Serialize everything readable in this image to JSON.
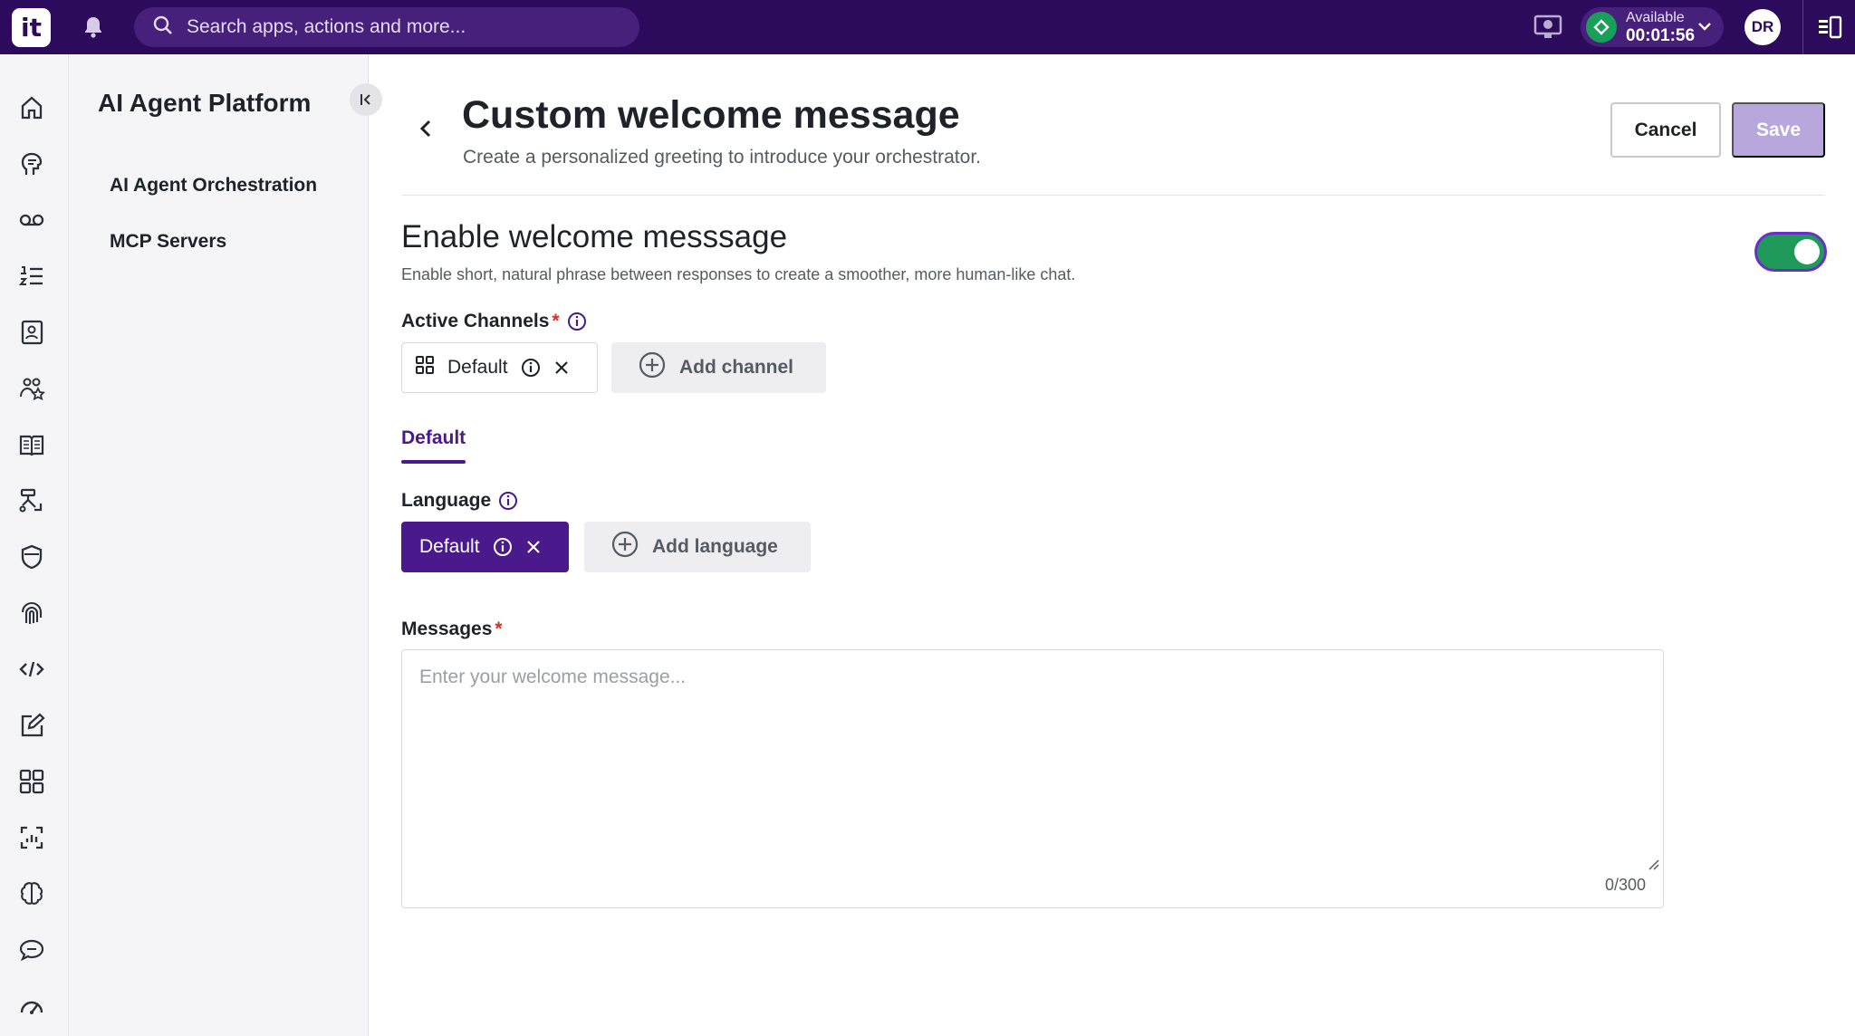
{
  "topbar": {
    "logo_text": "it",
    "search_placeholder": "Search apps, actions and more...",
    "status_label": "Available",
    "status_time": "00:01:56",
    "avatar_initials": "DR",
    "brand_color": "#2c0a5c"
  },
  "rail": {
    "icons": [
      "home-icon",
      "agent-head-icon",
      "voicemail-icon",
      "numbered-list-icon",
      "contact-book-icon",
      "team-star-icon",
      "open-book-icon",
      "flow-icon",
      "shield-icon",
      "fingerprint-icon",
      "code-icon",
      "edit-icon",
      "apps-grid-icon",
      "analytics-icon",
      "brain-icon",
      "chat-bubble-icon",
      "speedometer-icon"
    ]
  },
  "sidebar": {
    "title": "AI Agent Platform",
    "items": [
      {
        "label": "AI Agent Orchestration"
      },
      {
        "label": "MCP Servers"
      }
    ]
  },
  "header": {
    "title": "Custom welcome message",
    "subtitle": "Create a personalized greeting to introduce your orchestrator.",
    "cancel_label": "Cancel",
    "save_label": "Save"
  },
  "welcome": {
    "title": "Enable welcome messsage",
    "description": "Enable short, natural phrase between responses to create a smoother, more human-like chat.",
    "enabled": true
  },
  "channels": {
    "label": "Active Channels",
    "required": "*",
    "chip_label": "Default",
    "add_label": "Add channel"
  },
  "tabs": [
    {
      "label": "Default",
      "active": true
    }
  ],
  "language": {
    "label": "Language",
    "chip_label": "Default",
    "add_label": "Add language"
  },
  "messages": {
    "label": "Messages",
    "required": "*",
    "value": "",
    "placeholder": "Enter your welcome message...",
    "counter": "0/300"
  },
  "colors": {
    "accent": "#4a1a8c",
    "toggle_on": "#1f9a5a",
    "save_disabled": "#b8a7dc"
  }
}
